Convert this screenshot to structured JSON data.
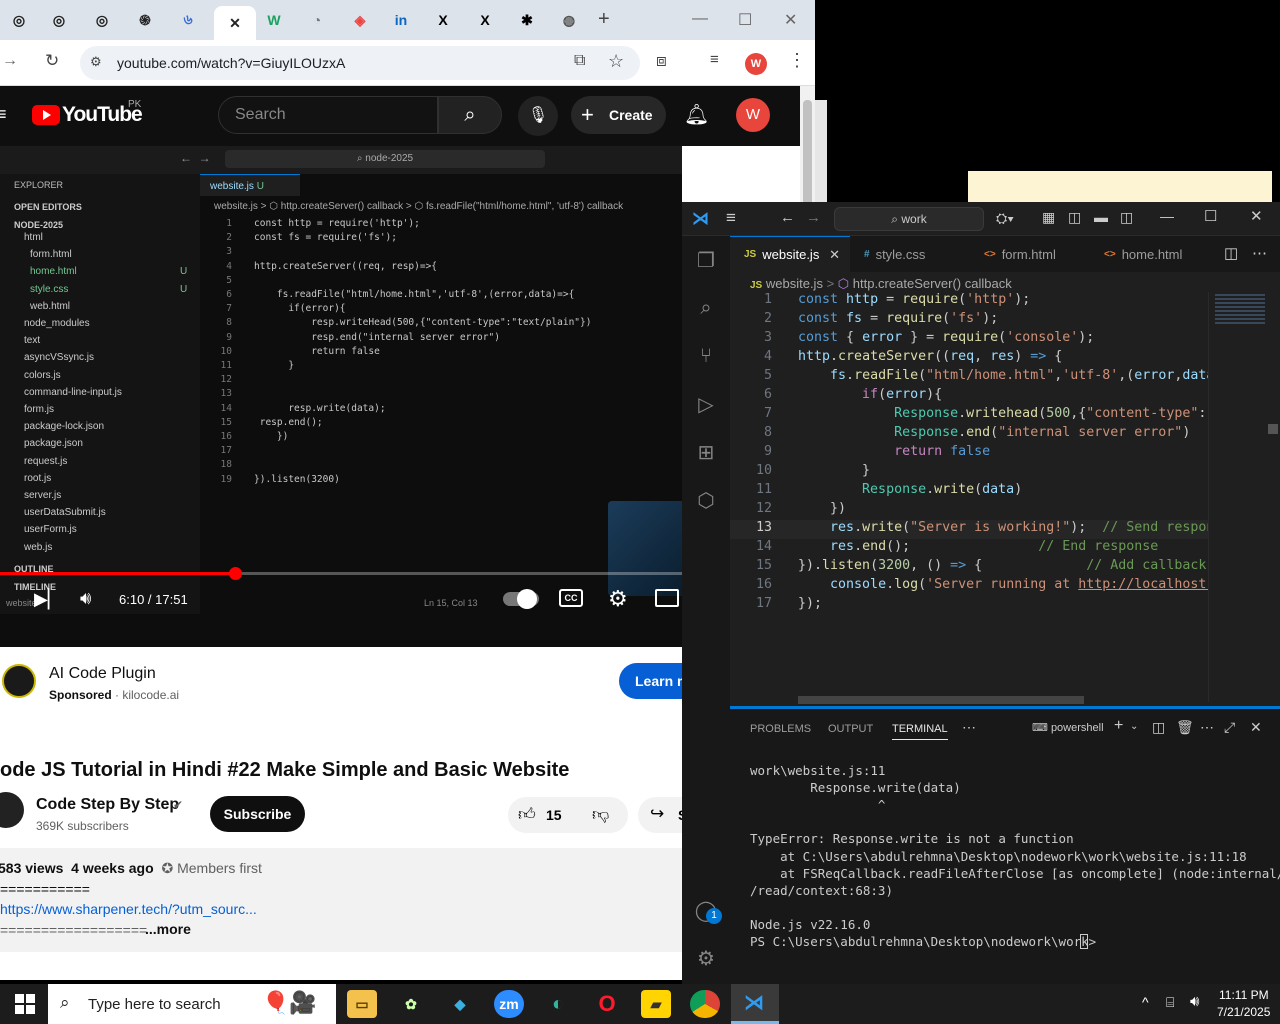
{
  "browser": {
    "url": "youtube.com/watch?v=GiuyILOUzxA",
    "profile_initial": "W",
    "tabs": [
      {
        "glyph": "◎",
        "color": "#222"
      },
      {
        "glyph": "◎",
        "color": "#222"
      },
      {
        "glyph": "◎",
        "color": "#222"
      },
      {
        "glyph": "֍",
        "color": "#222"
      },
      {
        "glyph": "৬",
        "color": "#3a6ed6"
      },
      {
        "glyph": "✕",
        "color": "#222",
        "active": true
      },
      {
        "glyph": "W",
        "color": "#1aa260"
      },
      {
        "glyph": "◔",
        "color": "#777"
      },
      {
        "glyph": "◈",
        "color": "#e44"
      },
      {
        "glyph": "in",
        "color": "#0a66c2"
      },
      {
        "glyph": "X",
        "color": "#000"
      },
      {
        "glyph": "X",
        "color": "#000"
      },
      {
        "glyph": "✱",
        "color": "#000"
      },
      {
        "glyph": "◍",
        "color": "#555"
      }
    ],
    "new_tab": "+"
  },
  "youtube": {
    "logo": "YouTube",
    "region": "PK",
    "search_placeholder": "Search",
    "create_label": "Create",
    "avatar": "W",
    "time": "6:10 / 17:51",
    "progress": 0.345,
    "ad": {
      "title": "AI Code Plugin",
      "sponsored": "Sponsored",
      "domain": "kilocode.ai",
      "cta": "Learn m"
    },
    "video_title": "ode JS Tutorial in Hindi #22 Make Simple and Basic Website",
    "channel": "Code Step By Step",
    "subscribers": "369K subscribers",
    "subscribe": "Subscribe",
    "likes": "15",
    "share": "S",
    "meta": {
      "views": "583 views",
      "ago": "4 weeks ago",
      "members": "Members first"
    },
    "desc_rule": "===========",
    "desc_link": "https://www.sharpener.tech/?utm_sourc...",
    "desc_rule2": "==================",
    "more": "...more"
  },
  "video_vscode": {
    "search": "node-2025",
    "explorer_title": "EXPLORER",
    "open_editors": "OPEN EDITORS",
    "project": "NODE-2025",
    "tab": "website.js",
    "tab_status": "U",
    "breadcrumb": "website.js > ⬡ http.createServer() callback > ⬡ fs.readFile(\"html/home.html\", 'utf-8') callback",
    "files": [
      {
        "name": "html",
        "indent": 1,
        "folder": true
      },
      {
        "name": "form.html",
        "indent": 2
      },
      {
        "name": "home.html",
        "indent": 2,
        "status": "U",
        "color": "#73c991"
      },
      {
        "name": "style.css",
        "indent": 2,
        "status": "U",
        "color": "#73c991"
      },
      {
        "name": "web.html",
        "indent": 2
      },
      {
        "name": "node_modules",
        "indent": 1,
        "folder": true
      },
      {
        "name": "text",
        "indent": 1,
        "folder": true
      },
      {
        "name": "asyncVSsync.js",
        "indent": 1
      },
      {
        "name": "colors.js",
        "indent": 1
      },
      {
        "name": "command-line-input.js",
        "indent": 1
      },
      {
        "name": "form.js",
        "indent": 1
      },
      {
        "name": "package-lock.json",
        "indent": 1
      },
      {
        "name": "package.json",
        "indent": 1
      },
      {
        "name": "request.js",
        "indent": 1
      },
      {
        "name": "root.js",
        "indent": 1
      },
      {
        "name": "server.js",
        "indent": 1
      },
      {
        "name": "userDataSubmit.js",
        "indent": 1
      },
      {
        "name": "userForm.js",
        "indent": 1
      },
      {
        "name": "web.js",
        "indent": 1
      }
    ],
    "outline": "OUTLINE",
    "timeline": "TIMELINE",
    "status_left": "website",
    "status_pos": "Ln 15, Col 13",
    "code": [
      {
        "n": "1",
        "t": "const http = require('http');"
      },
      {
        "n": "2",
        "t": "const fs = require('fs');"
      },
      {
        "n": "3",
        "t": ""
      },
      {
        "n": "4",
        "t": "http.createServer((req, resp)=>{"
      },
      {
        "n": "5",
        "t": ""
      },
      {
        "n": "6",
        "t": "    fs.readFile(\"html/home.html\",'utf-8',(error,data)=>{"
      },
      {
        "n": "7",
        "t": "      if(error){"
      },
      {
        "n": "8",
        "t": "          resp.writeHead(500,{\"content-type\":\"text/plain\"})"
      },
      {
        "n": "9",
        "t": "          resp.end(\"internal server error\")"
      },
      {
        "n": "10",
        "t": "          return false"
      },
      {
        "n": "11",
        "t": "      }"
      },
      {
        "n": "12",
        "t": ""
      },
      {
        "n": "13",
        "t": ""
      },
      {
        "n": "14",
        "t": "      resp.write(data);"
      },
      {
        "n": "15",
        "t": " resp.end();"
      },
      {
        "n": "16",
        "t": "    })"
      },
      {
        "n": "17",
        "t": ""
      },
      {
        "n": "18",
        "t": ""
      },
      {
        "n": "19",
        "t": "}).listen(3200)"
      }
    ]
  },
  "vscode": {
    "search": "work",
    "tabs": [
      {
        "label": "website.js",
        "prefix": "JS",
        "prefix_color": "#cbcb41",
        "active": true
      },
      {
        "label": "style.css",
        "prefix": "#",
        "prefix_color": "#519aba"
      },
      {
        "label": "form.html",
        "prefix": "<>",
        "prefix_color": "#e37933"
      },
      {
        "label": "home.html",
        "prefix": "<>",
        "prefix_color": "#e37933"
      }
    ],
    "breadcrumb_file": "website.js",
    "breadcrumb_symbol": "http.createServer() callback",
    "badge": "1",
    "panel_tabs": [
      "PROBLEMS",
      "OUTPUT",
      "TERMINAL"
    ],
    "active_panel": "TERMINAL",
    "shell": "powershell",
    "terminal": [
      "work\\website.js:11",
      "        Response.write(data)",
      "                 ^",
      "",
      "TypeError: Response.write is not a function",
      "    at C:\\Users\\abdulrehmna\\Desktop\\nodework\\work\\website.js:11:18",
      "    at FSReqCallback.readFileAfterClose [as oncomplete] (node:internal/fs",
      "/read/context:68:3)",
      "",
      "Node.js v22.16.0",
      "PS C:\\Users\\abdulrehmna\\Desktop\\nodework\\work> "
    ]
  },
  "taskbar": {
    "search_placeholder": "Type here to search",
    "time": "11:11 PM",
    "date": "7/21/2025"
  }
}
